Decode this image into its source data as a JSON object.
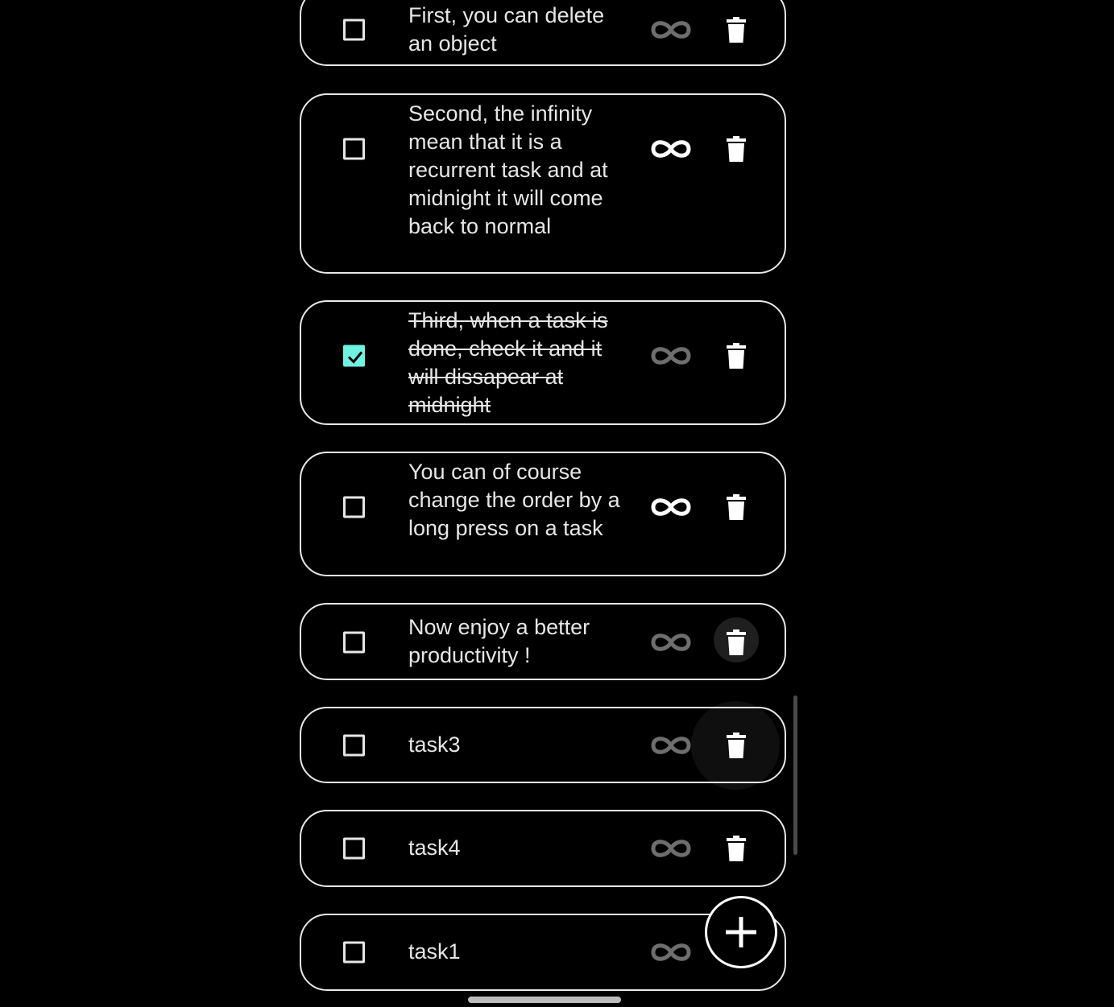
{
  "tasks": [
    {
      "text": "First, you can delete an object",
      "checked": false,
      "recurring": false
    },
    {
      "text": "Second, the infinity mean that it is a recurrent task and at midnight it will come back to normal",
      "checked": false,
      "recurring": true
    },
    {
      "text": "Third, when a task is done, check it and it will dissapear at midnight",
      "checked": true,
      "recurring": false
    },
    {
      "text": "You can of course change the order by a long press on a task",
      "checked": false,
      "recurring": true
    },
    {
      "text": "Now enjoy a better productivity !",
      "checked": false,
      "recurring": false
    },
    {
      "text": "task3",
      "checked": false,
      "recurring": false
    },
    {
      "text": "task4",
      "checked": false,
      "recurring": false
    },
    {
      "text": "task1",
      "checked": false,
      "recurring": false
    }
  ],
  "icons": {
    "checkbox": "checkbox-icon",
    "recurring": "infinity-icon",
    "delete": "trash-icon",
    "add": "plus-icon"
  },
  "colors": {
    "background": "#000000",
    "checked_accent": "#6ff2e2",
    "recurring_active": "#ffffff",
    "recurring_inactive": "#6e6e6e",
    "border": "#e8e8e8"
  }
}
